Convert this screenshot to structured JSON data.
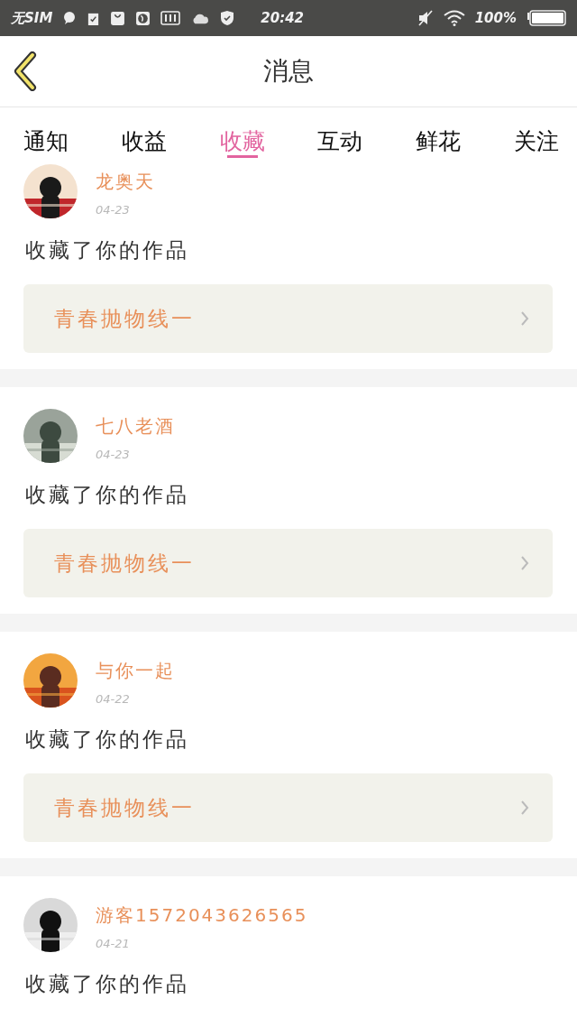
{
  "status_bar": {
    "carrier": "无SIM",
    "time": "20:42",
    "battery": "100%"
  },
  "header": {
    "title": "消息"
  },
  "tabs": [
    {
      "label": "通知",
      "selected": false
    },
    {
      "label": "收益",
      "selected": false
    },
    {
      "label": "收藏",
      "selected": true
    },
    {
      "label": "互动",
      "selected": false
    },
    {
      "label": "鲜花",
      "selected": false
    },
    {
      "label": "关注",
      "selected": false
    }
  ],
  "messages": [
    {
      "name": "龙奥天",
      "date": "04-23",
      "action": "收藏了你的作品",
      "work": "青春抛物线一"
    },
    {
      "name": "七八老酒",
      "date": "04-23",
      "action": "收藏了你的作品",
      "work": "青春抛物线一"
    },
    {
      "name": "与你一起",
      "date": "04-22",
      "action": "收藏了你的作品",
      "work": "青春抛物线一"
    },
    {
      "name": "游客1572043626565",
      "date": "04-21",
      "action": "收藏了你的作品"
    }
  ]
}
